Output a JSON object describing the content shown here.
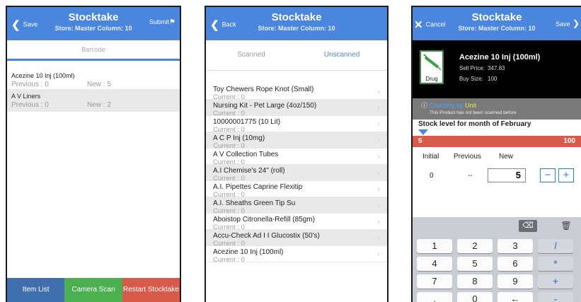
{
  "colors": {
    "primary": "#4a86dd",
    "green": "#4caf50",
    "red": "#d75a4a",
    "black": "#000000"
  },
  "phone1": {
    "nav": {
      "back_label": "Save",
      "title": "Stocktake",
      "subtitle": "Store: Master  Column: 10",
      "right_label": "Submit",
      "right_icon": "flag-icon"
    },
    "barcode_placeholder": "Barcode",
    "items": [
      {
        "name": "Acezine 10 Inj (100ml)",
        "previous": "Previous : 0",
        "new": "New : 5"
      },
      {
        "name": "A V Liners",
        "previous": "Previous : 0",
        "new": "New : 2"
      }
    ],
    "tabs": [
      {
        "label": "Item List",
        "color": "#3f6fae"
      },
      {
        "label": "Camera Scan",
        "color": "#4caf50"
      },
      {
        "label": "Restart Stocktake",
        "color": "#d75a4a"
      }
    ]
  },
  "phone2": {
    "nav": {
      "back_label": "Back",
      "title": "Stocktake",
      "subtitle": "Store: Master  Column: 10"
    },
    "segments": {
      "scanned": "Scanned",
      "unscanned": "Unscanned"
    },
    "items": [
      {
        "name": "Toy Chewers Rope Knot (Small)",
        "current": "Current : 0"
      },
      {
        "name": "Nursing Kit - Pet Large (4oz/150)",
        "current": "Current : 0"
      },
      {
        "name": "10000001775 (10 Lit)",
        "current": "Current : 0"
      },
      {
        "name": "A C P Inj (10mg)",
        "current": "Current : 0"
      },
      {
        "name": "A V Collection Tubes",
        "current": "Current : 0"
      },
      {
        "name": "A.I Chemise's 24\" (roll)",
        "current": "Current : 0"
      },
      {
        "name": "A.I. Pipettes Caprine Flexitip",
        "current": "Current : 0"
      },
      {
        "name": "A.I. Sheaths Green Tip Su",
        "current": "Current : 0"
      },
      {
        "name": "Aboistop Citronella-Refill (85gm)",
        "current": "Current : 0"
      },
      {
        "name": "Accu-Check Ad I I Glucostix (50's)",
        "current": "Current : 0"
      },
      {
        "name": "Acezine 10 Inj (100ml)",
        "current": "Current : 0"
      }
    ]
  },
  "phone3": {
    "nav": {
      "left_label": "Cancel",
      "title": "Stocktake",
      "subtitle": "Store: Master  Column: 10",
      "right_label": "Save"
    },
    "product": {
      "name": "Acezine 10 Inj (100ml)",
      "sell_label": "Sell Price:",
      "sell_value": "347.83",
      "buy_label": "Buy Size:",
      "buy_value": "100",
      "icon_label": "Drug"
    },
    "counting": {
      "prefix": "Counting by ",
      "unit": "Unit",
      "note": "This Product has not been scanned before"
    },
    "stock_level": "Stock level for month of February",
    "bar": {
      "left": "5",
      "right": "100"
    },
    "columns": {
      "initial": "Initial",
      "previous": "Previous",
      "new": "New"
    },
    "values": {
      "initial": "0",
      "previous": "--",
      "new": "5"
    },
    "keys": [
      "1",
      "2",
      "3",
      "/",
      "4",
      "5",
      "6",
      "*",
      "7",
      "8",
      "9",
      "+",
      ".",
      "0",
      "←",
      "-"
    ]
  }
}
